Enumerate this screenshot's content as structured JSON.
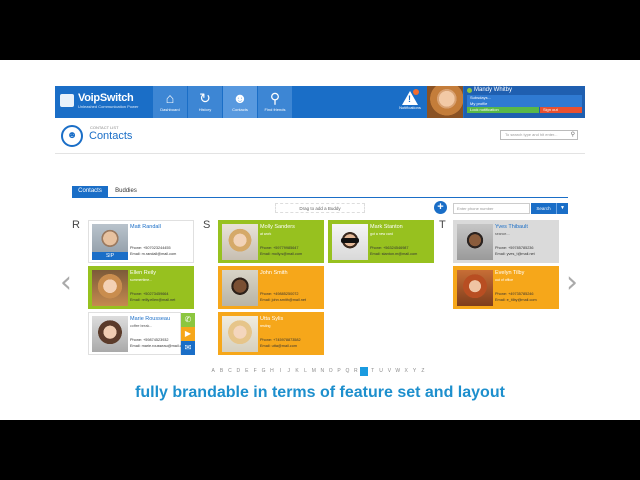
{
  "app": {
    "logo_name": "VoipSwitch",
    "logo_tagline": "Unleashed Communication Power",
    "nav": [
      {
        "label": "Dashboard",
        "icon": "home-icon"
      },
      {
        "label": "History",
        "icon": "history-icon"
      },
      {
        "label": "Contacts",
        "icon": "contacts-icon"
      },
      {
        "label": "Find friends",
        "icon": "search-icon"
      }
    ],
    "notifications_label": "Notifications",
    "user": {
      "name": "Mandy Whitby",
      "menu": [
        "Subsdays...",
        "My profile"
      ],
      "status": "Lock notification",
      "signout": "Sign out"
    }
  },
  "page": {
    "small_title": "CONTACT LIST",
    "title": "Contacts",
    "search_placeholder": "To search type and hit enter..."
  },
  "tabs": [
    "Contacts",
    "Buddies"
  ],
  "toolbar": {
    "drag_hint": "Drag to add a Buddy",
    "phone_placeholder": "Enter phone number",
    "search_label": "Search"
  },
  "letters": [
    "R",
    "S",
    "T"
  ],
  "contacts": [
    {
      "name": "Matt Randall",
      "status": "",
      "phone": "Phone: +507023244455",
      "email": "Email: m.randall@mail.com",
      "sip": "SIP"
    },
    {
      "name": "Ellen Reily",
      "status": "summertime...",
      "phone": "Phone: +50273459664",
      "email": "Email: reilly.ellen@mail.net"
    },
    {
      "name": "Marie Rousseau",
      "status": "coffee break...",
      "phone": "Phone: +59874523932",
      "email": "Email: marie.rousseau@mail.com"
    },
    {
      "name": "Molly Sanders",
      "status": "at work",
      "phone": "Phone: +59779985647",
      "email": "Email: molly.s@mail.com"
    },
    {
      "name": "John Smith",
      "status": "",
      "phone": "Phone: +49885250072",
      "email": "Email: john.smith@mail.net"
    },
    {
      "name": "Utta Sylis",
      "status": "resting",
      "phone": "Phone: +745978873582",
      "email": "Email: utta@mail.com"
    },
    {
      "name": "Mark Stanton",
      "status": "got a new card",
      "phone": "Phone: +56324546987",
      "email": "Email: stanton.m@mail.com"
    },
    {
      "name": "Yves Thibault",
      "status": "seance....",
      "phone": "Phone: +59785785236",
      "email": "Email: yves_t@mail.net"
    },
    {
      "name": "Evelyn Tilby",
      "status": "out of office",
      "phone": "Phone: +49735785246",
      "email": "Email: e_tilby@mail.com"
    }
  ],
  "alphabet": [
    "A",
    "B",
    "C",
    "D",
    "E",
    "F",
    "G",
    "H",
    "I",
    "J",
    "K",
    "L",
    "M",
    "N",
    "O",
    "P",
    "Q",
    "R",
    "S",
    "T",
    "U",
    "V",
    "W",
    "X",
    "Y",
    "Z"
  ],
  "caption": "fully brandable in terms of feature set and layout"
}
